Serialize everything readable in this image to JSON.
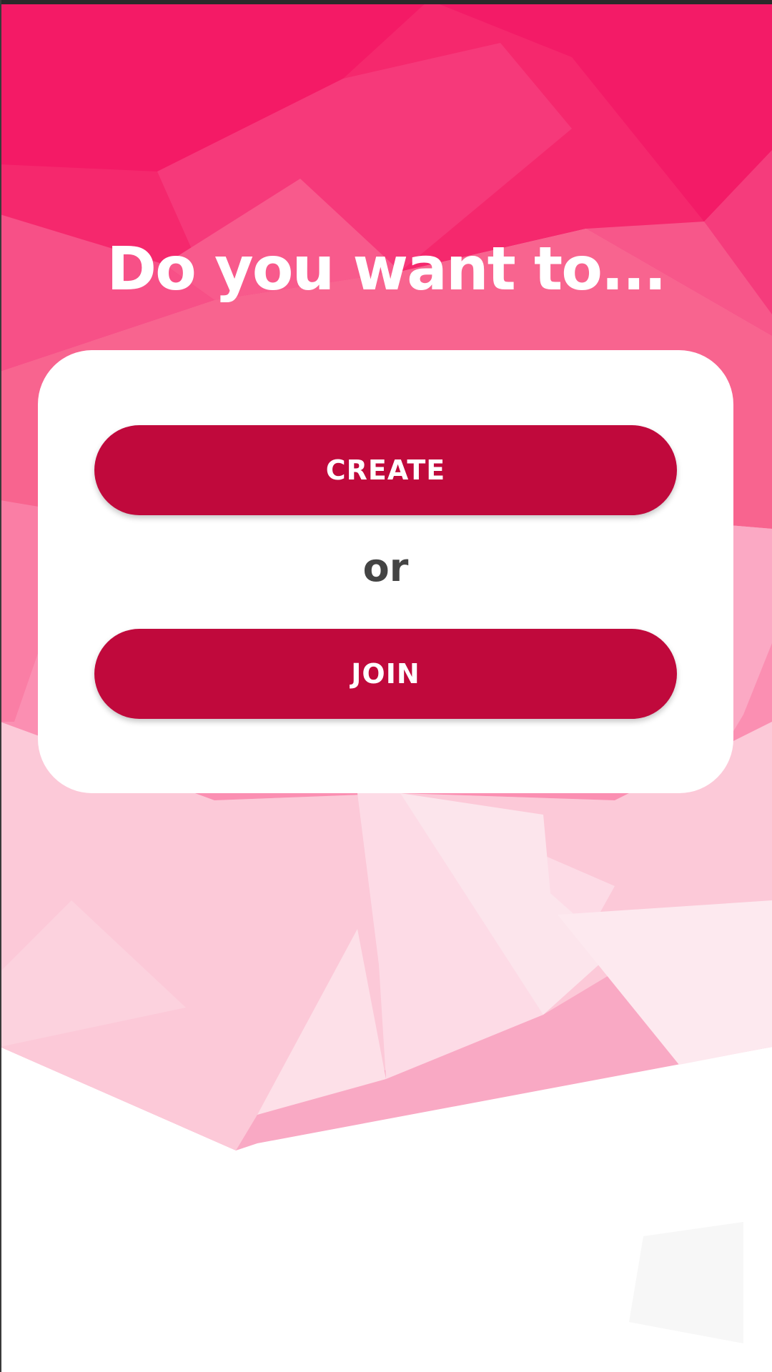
{
  "screen": {
    "heading": "Do you want to...",
    "create_label": "CREATE",
    "separator": "or",
    "join_label": "JOIN"
  },
  "colors": {
    "accent": "#c0093c",
    "background_top": "#f5196a",
    "card": "#ffffff",
    "separator_text": "#444444"
  }
}
